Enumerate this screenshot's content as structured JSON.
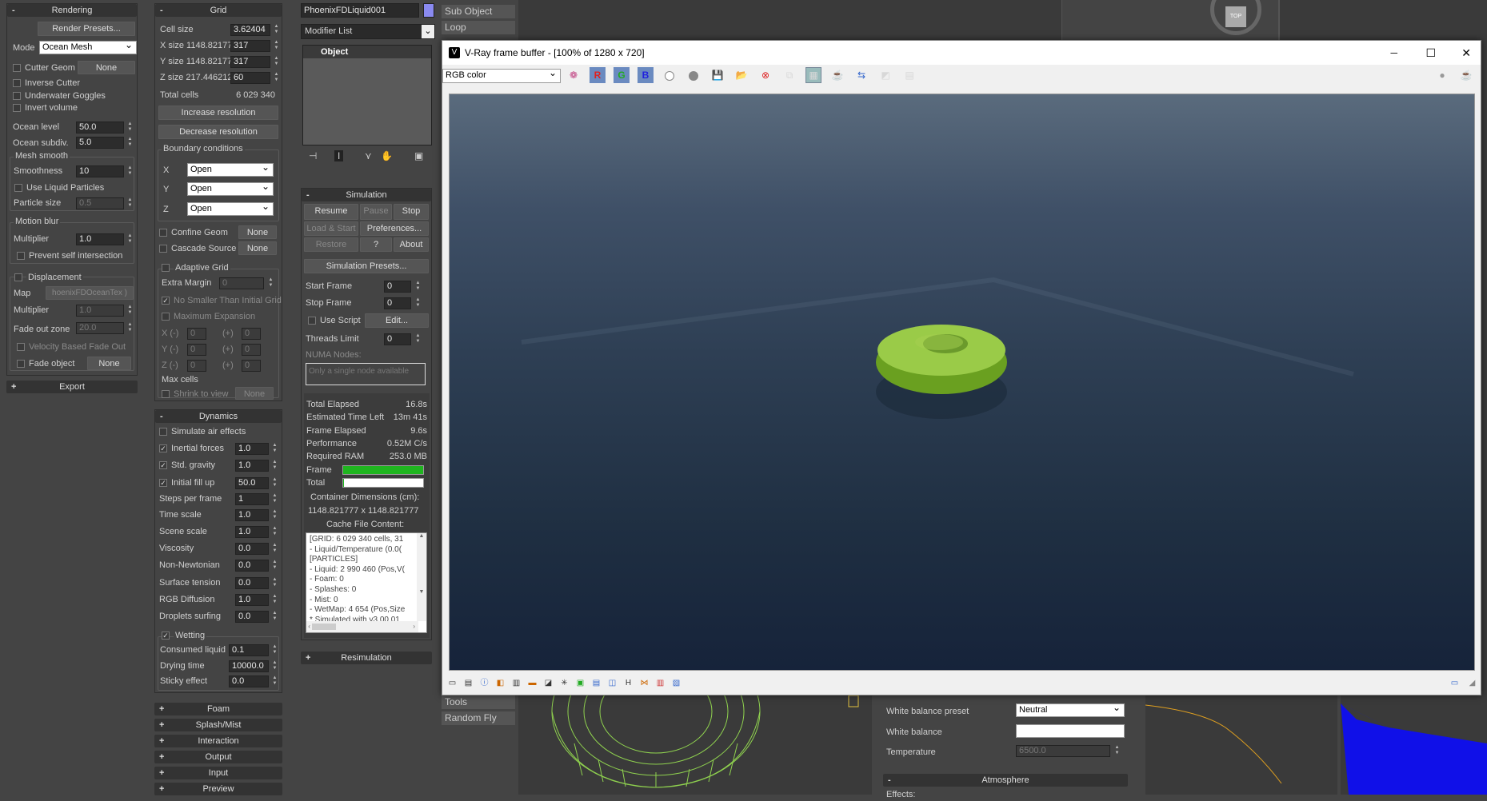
{
  "rendering": {
    "title": "Rendering",
    "render_presets": "Render Presets...",
    "mode_label": "Mode",
    "mode_value": "Ocean Mesh",
    "cutter_geom": "Cutter Geom",
    "cutter_none": "None",
    "inverse_cutter": "Inverse Cutter",
    "underwater_goggles": "Underwater Goggles",
    "invert_volume": "Invert volume",
    "ocean_level": "Ocean level",
    "ocean_level_val": "50.0",
    "ocean_subdiv": "Ocean subdiv.",
    "ocean_subdiv_val": "5.0",
    "mesh_smooth": "Mesh smooth",
    "smoothness": "Smoothness",
    "smoothness_val": "10",
    "use_liquid_particles": "Use Liquid Particles",
    "particle_size": "Particle size",
    "particle_size_val": "0.5",
    "motion_blur": "Motion blur",
    "multiplier": "Multiplier",
    "multiplier_val": "1.0",
    "prevent_self": "Prevent self intersection",
    "displacement": "Displacement",
    "map": "Map",
    "map_val": "hoenixFDOceanTex )",
    "disp_multiplier": "Multiplier",
    "disp_multiplier_val": "1.0",
    "fade_out_zone": "Fade out zone",
    "fade_out_val": "20.0",
    "velocity_fade": "Velocity Based Fade Out",
    "fade_object": "Fade object",
    "fade_none": "None",
    "export": "Export"
  },
  "grid": {
    "title": "Grid",
    "cell_size": "Cell size",
    "cell_size_val": "3.62404",
    "x_size": "X size",
    "x_size_v": "1148.82177",
    "x_cells": "317",
    "y_size": "Y size",
    "y_size_v": "1148.82177",
    "y_cells": "317",
    "z_size": "Z size",
    "z_size_v": "217.446212",
    "z_cells": "60",
    "total_cells": "Total cells",
    "total_cells_val": "6 029 340",
    "increase": "Increase resolution",
    "decrease": "Decrease resolution",
    "boundary": "Boundary conditions",
    "x": "X",
    "y": "Y",
    "z": "Z",
    "open": "Open",
    "confine_geom": "Confine Geom",
    "confine_none": "None",
    "cascade_source": "Cascade Source",
    "cascade_none": "None",
    "adaptive_grid": "Adaptive Grid",
    "extra_margin": "Extra Margin",
    "extra_margin_val": "0",
    "no_smaller": "No Smaller Than Initial Grid",
    "max_expansion": "Maximum Expansion",
    "xm": "X (-)",
    "ym": "Y (-)",
    "zm": "Z (-)",
    "plus": "(+)",
    "zero": "0",
    "max_cells": "Max cells",
    "shrink": "Shrink to view",
    "shrink_none": "None"
  },
  "dynamics": {
    "title": "Dynamics",
    "simulate_air": "Simulate air effects",
    "inertial": "Inertial forces",
    "inertial_val": "1.0",
    "std_gravity": "Std. gravity",
    "std_gravity_val": "1.0",
    "initial_fill": "Initial fill up",
    "initial_fill_val": "50.0",
    "steps": "Steps per frame",
    "steps_val": "1",
    "time_scale": "Time scale",
    "time_scale_val": "1.0",
    "scene_scale": "Scene scale",
    "scene_scale_val": "1.0",
    "viscosity": "Viscosity",
    "viscosity_val": "0.0",
    "non_newtonian": "Non-Newtonian",
    "non_newtonian_val": "0.0",
    "surface_tension": "Surface tension",
    "surface_tension_val": "0.0",
    "rgb_diffusion": "RGB Diffusion",
    "rgb_diffusion_val": "1.0",
    "droplets": "Droplets surfing",
    "droplets_val": "0.0",
    "wetting": "Wetting",
    "consumed": "Consumed liquid",
    "consumed_val": "0.1",
    "drying": "Drying time",
    "drying_val": "10000.0",
    "sticky": "Sticky effect",
    "sticky_val": "0.0"
  },
  "rollouts": [
    "Foam",
    "Splash/Mist",
    "Interaction",
    "Output",
    "Input",
    "Preview"
  ],
  "modifier": {
    "object_name": "PhoenixFDLiquid001",
    "color": "#8a8af0",
    "modifier_list": "Modifier List",
    "stack_item": "Object"
  },
  "simulation": {
    "title": "Simulation",
    "resume": "Resume",
    "pause": "Pause",
    "stop": "Stop",
    "load_start": "Load & Start",
    "preferences": "Preferences...",
    "restore": "Restore",
    "help": "?",
    "about": "About",
    "presets": "Simulation Presets...",
    "start_frame": "Start Frame",
    "start_frame_val": "0",
    "stop_frame": "Stop Frame",
    "stop_frame_val": "0",
    "use_script": "Use Script",
    "edit": "Edit...",
    "threads": "Threads Limit",
    "threads_val": "0",
    "numa": "NUMA Nodes:",
    "numa_msg": "Only a single node available",
    "total_elapsed": "Total Elapsed",
    "total_elapsed_val": "16.8s",
    "est_left": "Estimated Time Left",
    "est_left_val": "13m 41s",
    "frame_elapsed": "Frame Elapsed",
    "frame_elapsed_val": "9.6s",
    "performance": "Performance",
    "performance_val": "0.52M C/s",
    "required_ram": "Required RAM",
    "required_ram_val": "253.0 MB",
    "frame": "Frame",
    "frame_progress": 1.0,
    "total": "Total",
    "total_progress": 0.01,
    "container": "Container Dimensions (cm):",
    "container_val": "1148.821777 x 1148.821777",
    "cache": "Cache File Content:",
    "cache_lines": [
      "[GRID: 6 029 340 cells, 31",
      "- Liquid/Temperature (0.0(",
      "[PARTICLES]",
      "- Liquid: 2 990 460 (Pos,V(",
      "- Foam: 0",
      "- Splashes: 0",
      "- Mist: 0",
      "- WetMap: 4 654 (Pos,Size",
      "* Simulated with v3.00.01"
    ],
    "resimulation": "Resimulation"
  },
  "top": {
    "sub_object": "Sub Object",
    "loop": "Loop",
    "tools": "Tools",
    "random_fly": "Random Fly"
  },
  "vfb": {
    "title": "V-Ray frame buffer - [100% of 1280 x 720]",
    "channel": "RGB color",
    "minimize": "─",
    "maximize": "☐",
    "close": "✕"
  },
  "vray_panel": {
    "wb_preset": "White balance preset",
    "wb_preset_val": "Neutral",
    "white_balance": "White balance",
    "temperature": "Temperature",
    "temperature_val": "6500.0",
    "atmosphere": "Atmosphere",
    "effects": "Effects:"
  },
  "viewcube": {
    "label": "TOP"
  }
}
